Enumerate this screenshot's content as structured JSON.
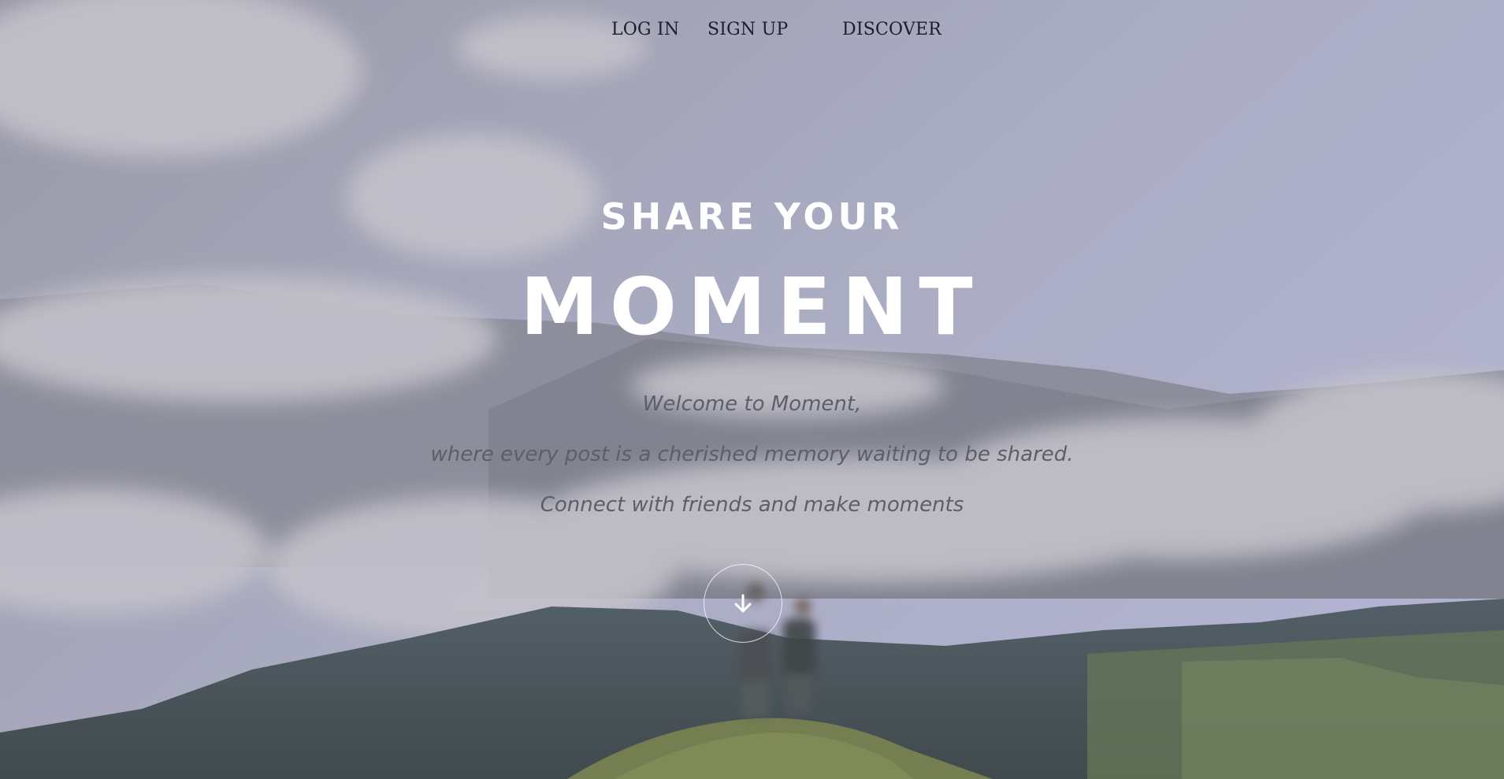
{
  "nav": {
    "login_label": "LOG IN",
    "signup_label": "SIGN UP",
    "discover_label": "DISCOVER"
  },
  "hero": {
    "headline_small": "SHARE YOUR",
    "headline_big": "MOMENT",
    "tagline_1": "Welcome to Moment,",
    "tagline_2": "where every post is a cherished memory waiting to be shared.",
    "tagline_3": "Connect with friends and make moments",
    "scroll_icon": "arrow-down-icon"
  },
  "colors": {
    "headline": "#ffffff",
    "tagline": "#5c5e6a",
    "nav_text": "#1c1f2b"
  }
}
